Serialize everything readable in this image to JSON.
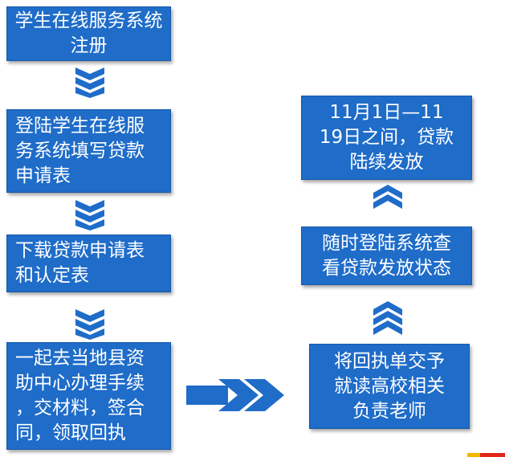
{
  "steps": {
    "register": "学生在线服务系统\n注册",
    "apply": "登陆学生在线服\n务系统填写贷款\n申请表",
    "download": "下载贷款申请表\n和认定表",
    "local": "一起去当地县资\n助中心办理手续\n，交材料，签合\n同，领取回执",
    "submit": "将回执单交予\n就读高校相关\n负责老师",
    "check": "随时登陆系统查\n看贷款发放状态",
    "release": "11月1日—11\n19日之间，贷款\n陆续发放"
  },
  "colors": {
    "box": "#1f6cc9",
    "arrow": "#1f6cc9",
    "text": "#ffffff"
  }
}
